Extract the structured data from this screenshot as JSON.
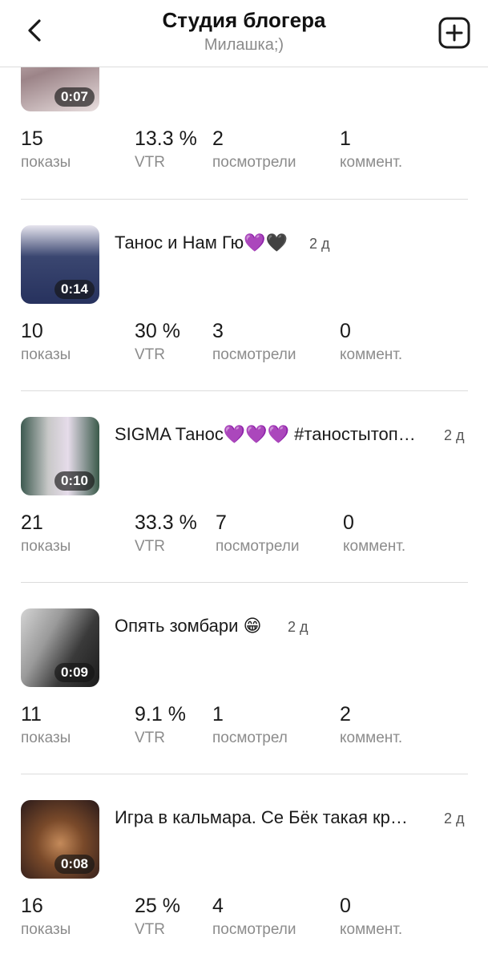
{
  "header": {
    "title": "Студия блогера",
    "subtitle": "Милашка;)"
  },
  "videos": [
    {
      "title": "",
      "age": "",
      "duration": "0:07",
      "stats": {
        "shows": "15",
        "shows_label": "показы",
        "vtr": "13.3 %",
        "vtr_label": "VTR",
        "viewed": "2",
        "viewed_label": "посмотрели",
        "comments": "1",
        "comments_label": "коммент."
      }
    },
    {
      "title": "Танос и Нам Гю💜🖤",
      "age": "2 д",
      "duration": "0:14",
      "stats": {
        "shows": "10",
        "shows_label": "показы",
        "vtr": "30 %",
        "vtr_label": "VTR",
        "viewed": "3",
        "viewed_label": "посмотрели",
        "comments": "0",
        "comments_label": "коммент."
      }
    },
    {
      "title": "SIGMA Танос💜💜💜 #таностытоп…",
      "age": "2 д",
      "duration": "0:10",
      "stats": {
        "shows": "21",
        "shows_label": "показы",
        "vtr": "33.3 %",
        "vtr_label": "VTR",
        "viewed": "7",
        "viewed_label": "посмотрели",
        "comments": "0",
        "comments_label": "коммент."
      }
    },
    {
      "title": "Опять зомбари 😁",
      "age": "2 д",
      "duration": "0:09",
      "stats": {
        "shows": "11",
        "shows_label": "показы",
        "vtr": "9.1 %",
        "vtr_label": "VTR",
        "viewed": "1",
        "viewed_label": "посмотрел",
        "comments": "2",
        "comments_label": "коммент."
      }
    },
    {
      "title": "Игра в кальмара. Се Бёк такая кр…",
      "age": "2 д",
      "duration": "0:08",
      "stats": {
        "shows": "16",
        "shows_label": "показы",
        "vtr": "25 %",
        "vtr_label": "VTR",
        "viewed": "4",
        "viewed_label": "посмотрели",
        "comments": "0",
        "comments_label": "коммент."
      }
    }
  ]
}
